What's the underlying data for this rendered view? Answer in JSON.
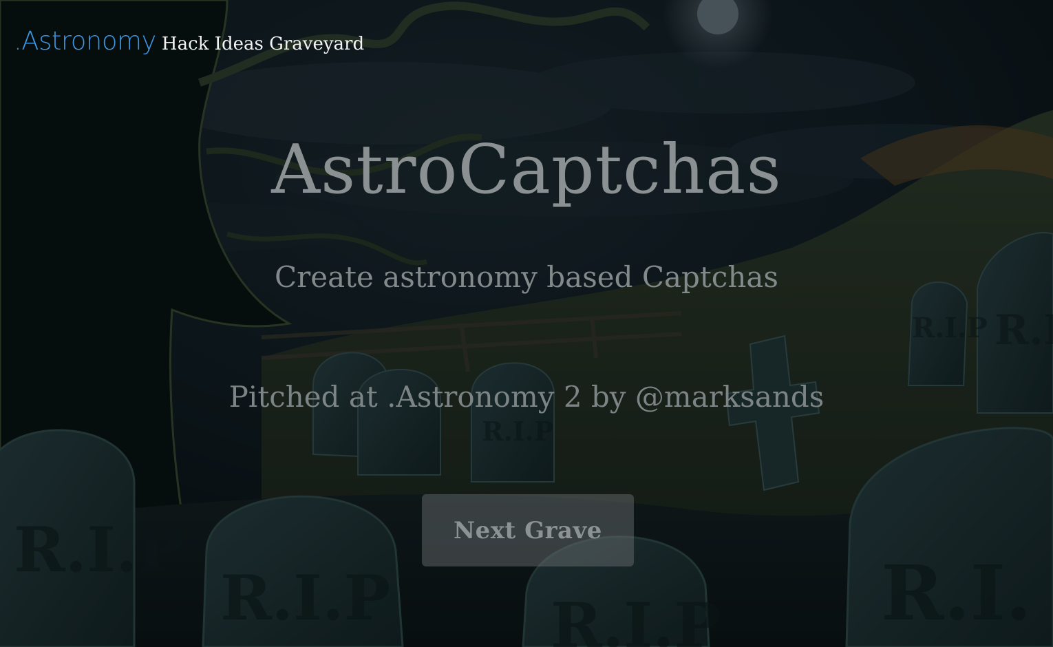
{
  "header": {
    "logo": ".Astronomy",
    "subtitle": "Hack Ideas Graveyard"
  },
  "idea": {
    "title": "AstroCaptchas",
    "description": "Create astronomy based Captchas",
    "pitched": "Pitched at .Astronomy 2 by @marksands"
  },
  "actions": {
    "next_label": "Next Grave"
  },
  "background": {
    "scene": "graveyard at night",
    "headstone_text": "R.I.P",
    "colors": {
      "sky": "#0f1c22",
      "hill": "#2a3a2a",
      "headstone": "#1f3436",
      "moon": "#6f7f88",
      "logo_blue": "#3d97e3"
    }
  }
}
